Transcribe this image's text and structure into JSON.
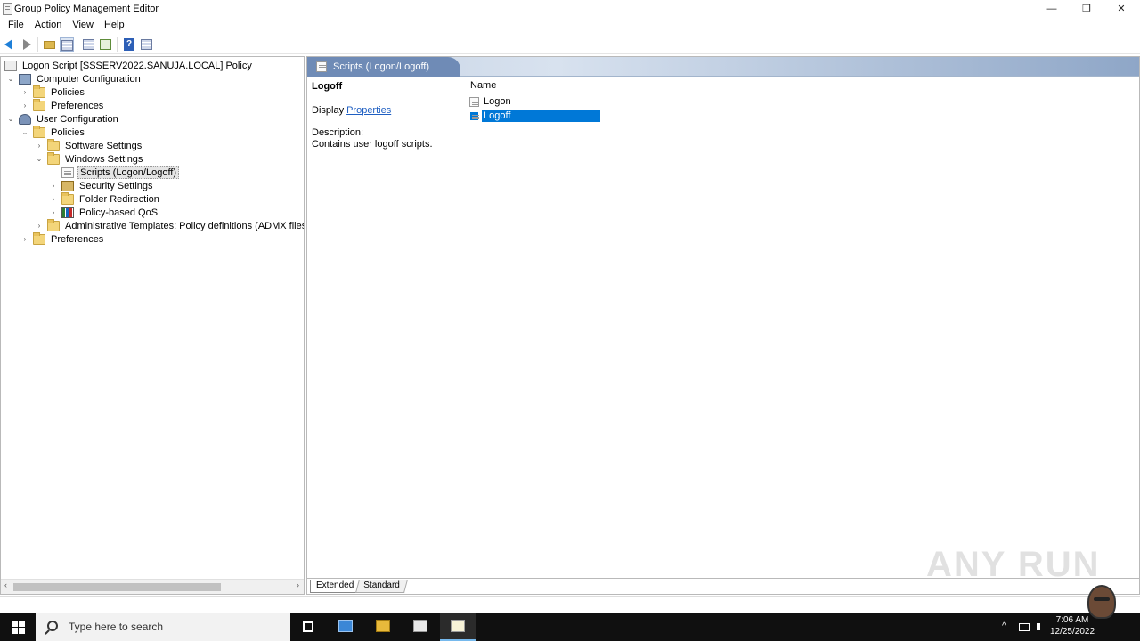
{
  "window": {
    "title": "Group Policy Management Editor",
    "minimize": "—",
    "maximize": "❐",
    "close": "✕"
  },
  "menu": [
    "File",
    "Action",
    "View",
    "Help"
  ],
  "tree": {
    "root": "Logon Script [SSSERV2022.SANUJA.LOCAL] Policy",
    "items": [
      {
        "label": "Computer Configuration",
        "expander": "⌄"
      },
      {
        "label": "Policies",
        "expander": "›"
      },
      {
        "label": "Preferences",
        "expander": "›"
      },
      {
        "label": "User Configuration",
        "expander": "⌄"
      },
      {
        "label": "Policies",
        "expander": "⌄"
      },
      {
        "label": "Software Settings",
        "expander": "›"
      },
      {
        "label": "Windows Settings",
        "expander": "⌄"
      },
      {
        "label": "Scripts (Logon/Logoff)",
        "expander": ""
      },
      {
        "label": "Security Settings",
        "expander": "›"
      },
      {
        "label": "Folder Redirection",
        "expander": "›"
      },
      {
        "label": "Policy-based QoS",
        "expander": "›"
      },
      {
        "label": "Administrative Templates: Policy definitions (ADMX files) retrieve",
        "expander": "›"
      },
      {
        "label": "Preferences",
        "expander": "›"
      }
    ]
  },
  "rightpane": {
    "header": "Scripts (Logon/Logoff)",
    "extended_title": "Logoff",
    "display_label": "Display",
    "properties_link": "Properties",
    "description_label": "Description:",
    "description_text": "Contains user logoff scripts.",
    "column_name": "Name",
    "items": [
      "Logon",
      "Logoff"
    ],
    "tabs": {
      "extended": "Extended",
      "standard": "Standard"
    }
  },
  "scrollbar": {
    "left_arrow": "‹",
    "right_arrow": "›"
  },
  "taskbar": {
    "search_placeholder": "Type here to search",
    "time": "7:06 AM",
    "date": "12/25/2022",
    "tray_chevron": "^"
  },
  "watermark": "ANY RUN"
}
